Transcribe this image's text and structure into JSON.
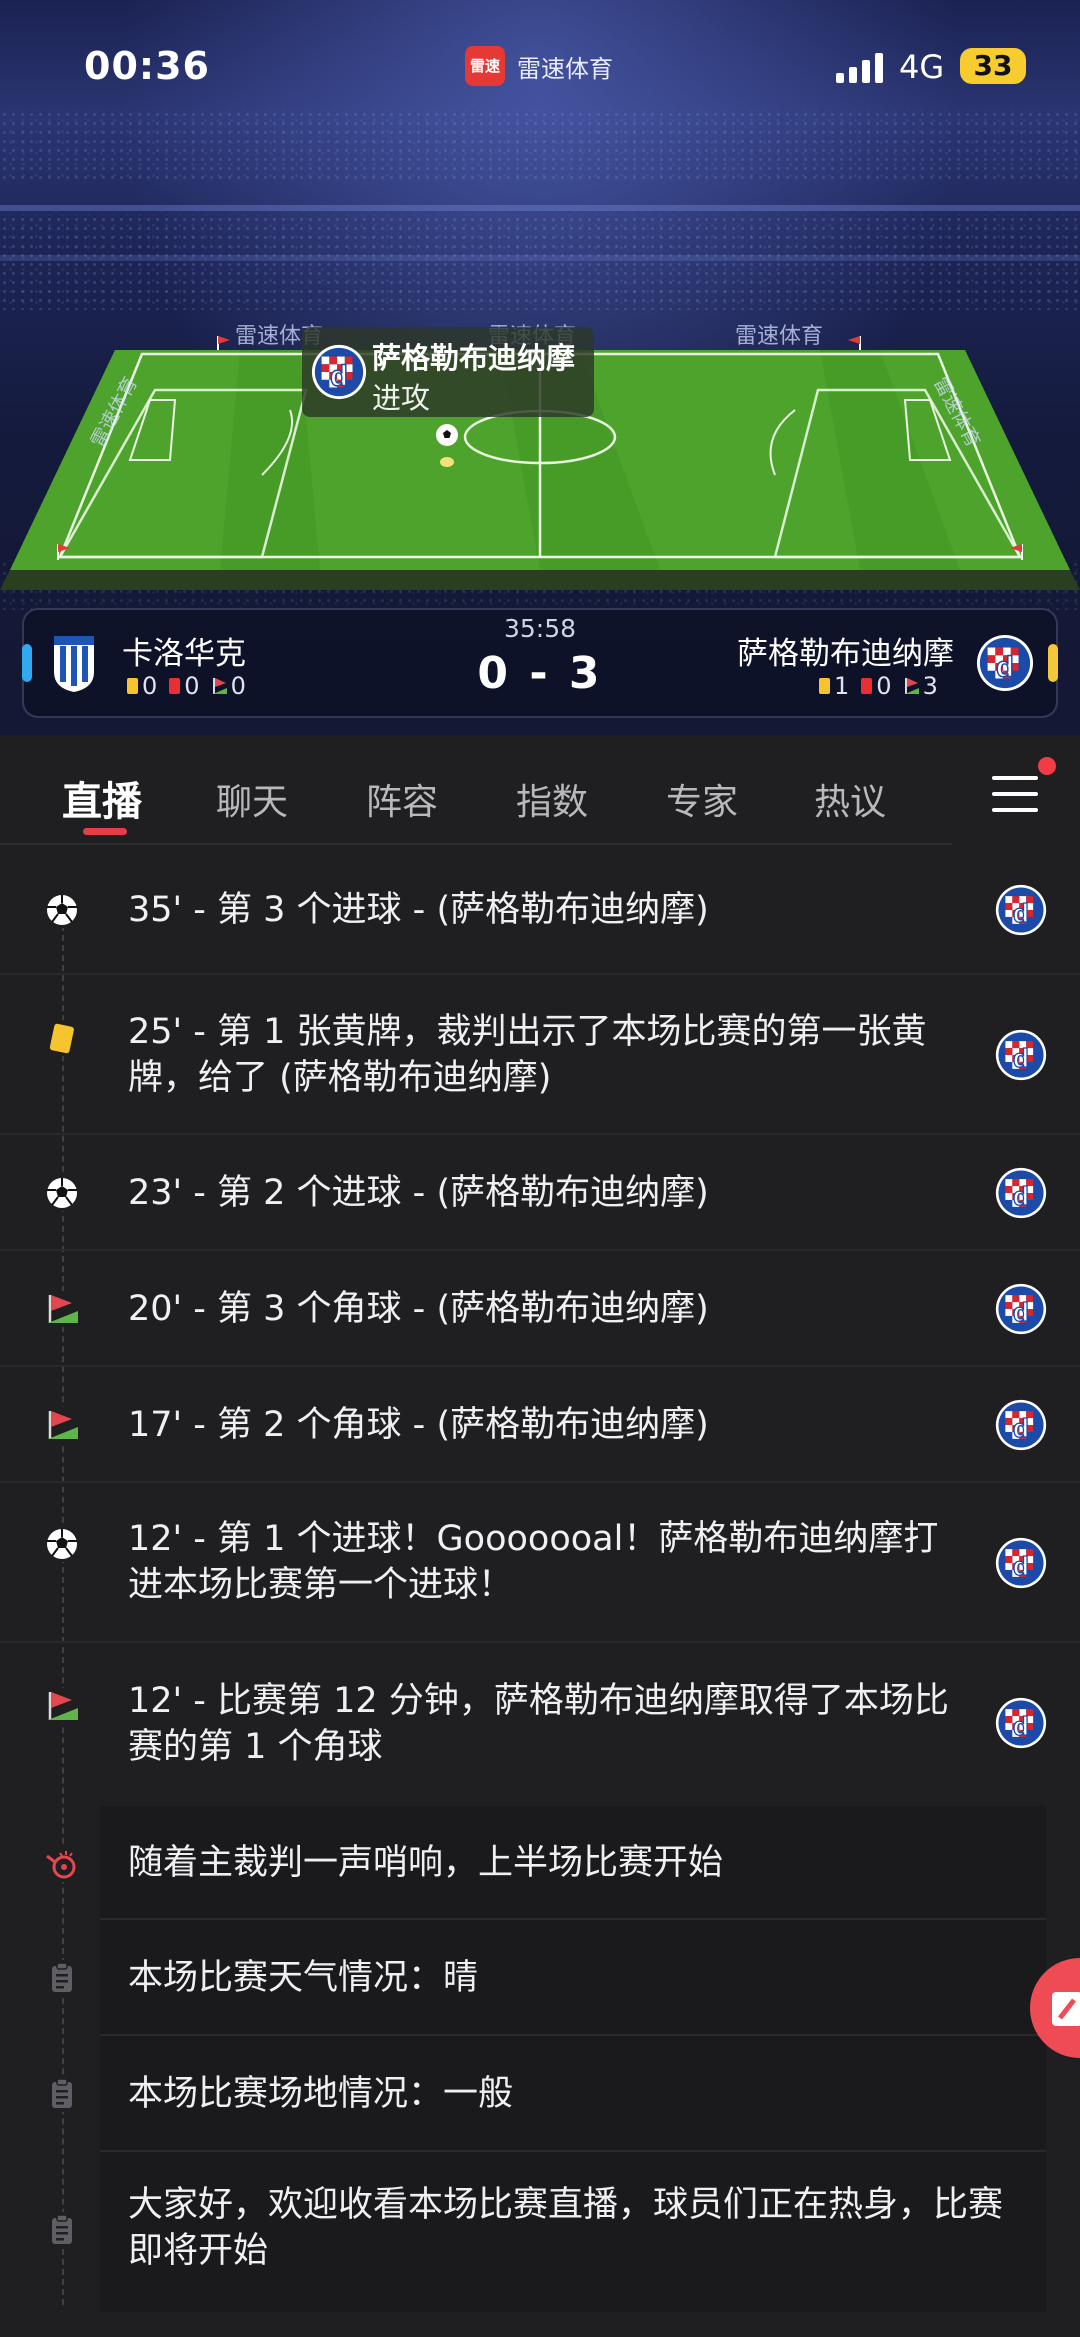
{
  "status_bar": {
    "time": "00:36",
    "app_logo_text": "雷速",
    "app_name": "雷速体育",
    "network": "4G",
    "battery": "33"
  },
  "ad_boards": [
    "雷速体育",
    "雷速体育",
    "雷速体育",
    "雷速体育",
    "雷速体育"
  ],
  "possession": {
    "team": "萨格勒布迪纳摩",
    "action": "进攻"
  },
  "match": {
    "clock": "35:58",
    "score": "0 - 3",
    "home": {
      "name": "卡洛华克",
      "yellow": "0",
      "red": "0",
      "corners": "0",
      "bar_color": "#31a9ee"
    },
    "away": {
      "name": "萨格勒布迪纳摩",
      "yellow": "1",
      "red": "0",
      "corners": "3",
      "bar_color": "#f4c63a"
    }
  },
  "tabs": [
    {
      "label": "直播",
      "active": true
    },
    {
      "label": "聊天"
    },
    {
      "label": "阵容"
    },
    {
      "label": "指数"
    },
    {
      "label": "专家"
    },
    {
      "label": "热议"
    }
  ],
  "events": [
    {
      "icon": "soccer-ball-icon",
      "text": "35' - 第 3 个进球 - (萨格勒布迪纳摩)",
      "team_logo": true
    },
    {
      "icon": "yellow-card-icon",
      "text": "25' - 第 1 张黄牌，裁判出示了本场比赛的第一张黄牌，给了 (萨格勒布迪纳摩)",
      "team_logo": true
    },
    {
      "icon": "soccer-ball-icon",
      "text": "23' - 第 2 个进球 - (萨格勒布迪纳摩)",
      "team_logo": true
    },
    {
      "icon": "corner-flag-icon",
      "text": "20' - 第 3 个角球 - (萨格勒布迪纳摩)",
      "team_logo": true
    },
    {
      "icon": "corner-flag-icon",
      "text": "17' - 第 2 个角球 - (萨格勒布迪纳摩)",
      "team_logo": true
    },
    {
      "icon": "soccer-ball-icon",
      "text": "12' - 第 1 个进球！Gooooooal！萨格勒布迪纳摩打进本场比赛第一个进球！",
      "team_logo": true
    },
    {
      "icon": "corner-flag-icon",
      "text": "12' - 比赛第 12 分钟，萨格勒布迪纳摩取得了本场比赛的第 1 个角球",
      "team_logo": true
    },
    {
      "icon": "whistle-icon",
      "text": "随着主裁判一声哨响，上半场比赛开始",
      "team_logo": false
    },
    {
      "icon": "clipboard-icon",
      "text": "本场比赛天气情况：晴",
      "team_logo": false
    },
    {
      "icon": "clipboard-icon",
      "text": "本场比赛场地情况：一般",
      "team_logo": false
    },
    {
      "icon": "clipboard-icon",
      "text": "大家好，欢迎收看本场比赛直播，球员们正在热身，比赛即将开始",
      "team_logo": false
    }
  ],
  "colors": {
    "accent": "#e63d4a",
    "background": "#1f1f22",
    "yellow_card": "#f6c42d",
    "red_card": "#ea2e35",
    "pitch_green": "#4da32c"
  }
}
